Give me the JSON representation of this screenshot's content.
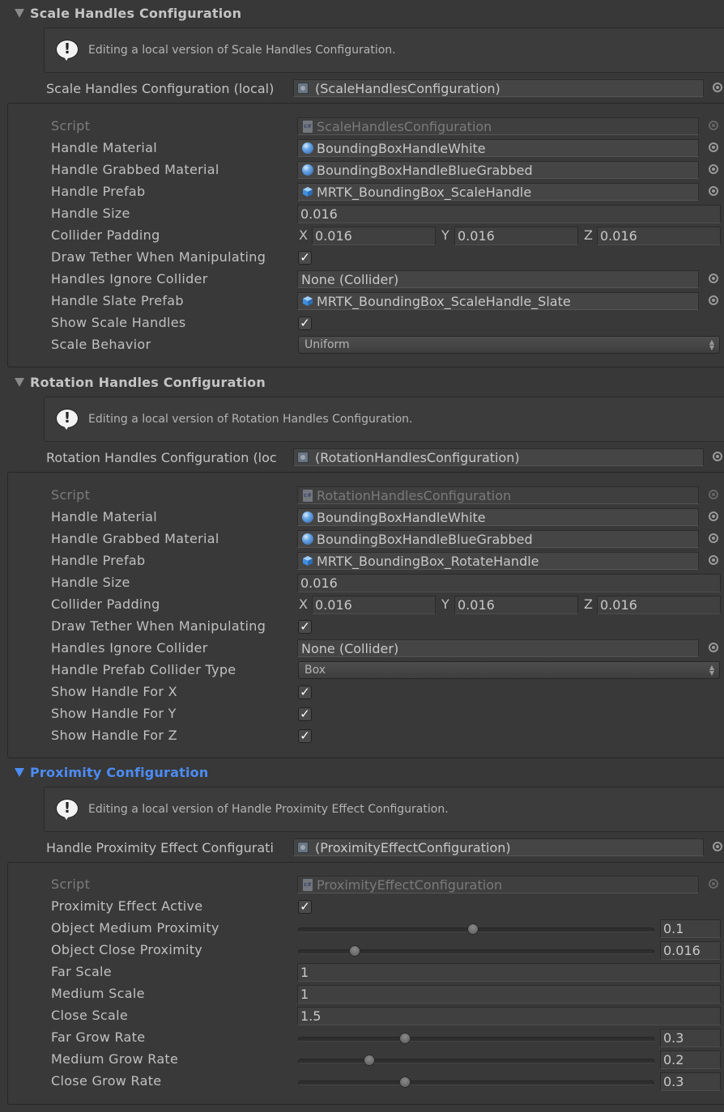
{
  "sections": {
    "scale": {
      "title": "Scale Handles Configuration",
      "help": "Editing a local version of Scale Handles Configuration.",
      "config_label": "Scale Handles Configuration (local)",
      "config_value": "(ScaleHandlesConfiguration)",
      "script_label": "Script",
      "script_value": "ScaleHandlesConfiguration",
      "props": {
        "handle_material": {
          "label": "Handle Material",
          "value": "BoundingBoxHandleWhite"
        },
        "handle_grabbed_material": {
          "label": "Handle Grabbed Material",
          "value": "BoundingBoxHandleBlueGrabbed"
        },
        "handle_prefab": {
          "label": "Handle Prefab",
          "value": "MRTK_BoundingBox_ScaleHandle"
        },
        "handle_size": {
          "label": "Handle Size",
          "value": "0.016"
        },
        "collider_padding": {
          "label": "Collider Padding",
          "x": "0.016",
          "y": "0.016",
          "z": "0.016"
        },
        "draw_tether": {
          "label": "Draw Tether When Manipulating",
          "checked": true
        },
        "handles_ignore_collider": {
          "label": "Handles Ignore Collider",
          "value": "None (Collider)"
        },
        "handle_slate_prefab": {
          "label": "Handle Slate Prefab",
          "value": "MRTK_BoundingBox_ScaleHandle_Slate"
        },
        "show_scale_handles": {
          "label": "Show Scale Handles",
          "checked": true
        },
        "scale_behavior": {
          "label": "Scale Behavior",
          "value": "Uniform"
        }
      }
    },
    "rotation": {
      "title": "Rotation Handles Configuration",
      "help": "Editing a local version of Rotation Handles Configuration.",
      "config_label": "Rotation Handles Configuration (loc",
      "config_value": "(RotationHandlesConfiguration)",
      "script_label": "Script",
      "script_value": "RotationHandlesConfiguration",
      "props": {
        "handle_material": {
          "label": "Handle Material",
          "value": "BoundingBoxHandleWhite"
        },
        "handle_grabbed_material": {
          "label": "Handle Grabbed Material",
          "value": "BoundingBoxHandleBlueGrabbed"
        },
        "handle_prefab": {
          "label": "Handle Prefab",
          "value": "MRTK_BoundingBox_RotateHandle"
        },
        "handle_size": {
          "label": "Handle Size",
          "value": "0.016"
        },
        "collider_padding": {
          "label": "Collider Padding",
          "x": "0.016",
          "y": "0.016",
          "z": "0.016"
        },
        "draw_tether": {
          "label": "Draw Tether When Manipulating",
          "checked": true
        },
        "handles_ignore_collider": {
          "label": "Handles Ignore Collider",
          "value": "None (Collider)"
        },
        "collider_type": {
          "label": "Handle Prefab Collider Type",
          "value": "Box"
        },
        "show_x": {
          "label": "Show Handle For X",
          "checked": true
        },
        "show_y": {
          "label": "Show Handle For Y",
          "checked": true
        },
        "show_z": {
          "label": "Show Handle For Z",
          "checked": true
        }
      }
    },
    "proximity": {
      "title": "Proximity Configuration",
      "help": "Editing a local version of Handle Proximity Effect Configuration.",
      "config_label": "Handle Proximity Effect Configurati",
      "config_value": "(ProximityEffectConfiguration)",
      "script_label": "Script",
      "script_value": "ProximityEffectConfiguration",
      "props": {
        "active": {
          "label": "Proximity Effect Active",
          "checked": true
        },
        "object_medium": {
          "label": "Object Medium Proximity",
          "value": "0.1",
          "slider_fraction": 0.49
        },
        "object_close": {
          "label": "Object Close Proximity",
          "value": "0.016",
          "slider_fraction": 0.16
        },
        "far_scale": {
          "label": "Far Scale",
          "value": "1"
        },
        "medium_scale": {
          "label": "Medium Scale",
          "value": "1"
        },
        "close_scale": {
          "label": "Close Scale",
          "value": "1.5"
        },
        "far_grow_rate": {
          "label": "Far Grow Rate",
          "value": "0.3",
          "slider_fraction": 0.3
        },
        "medium_grow_rate": {
          "label": "Medium Grow Rate",
          "value": "0.2",
          "slider_fraction": 0.2
        },
        "close_grow_rate": {
          "label": "Close Grow Rate",
          "value": "0.3",
          "slider_fraction": 0.3
        }
      }
    }
  },
  "axis_labels": {
    "x": "X",
    "y": "Y",
    "z": "Z"
  },
  "icons": {
    "help": "!",
    "check": "✓",
    "dropdown_arrows": "▲▼"
  },
  "colors": {
    "accent": "#4d8cf5",
    "background": "#383838",
    "text": "#c0c0c0"
  }
}
